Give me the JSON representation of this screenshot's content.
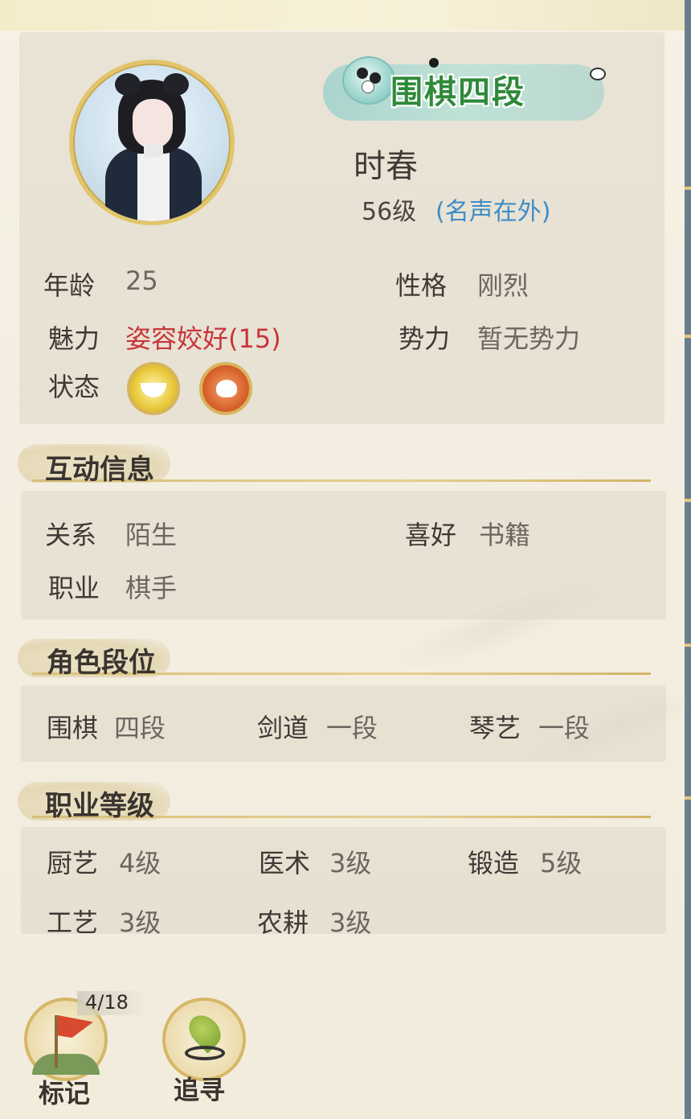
{
  "header": {
    "rank_badge": "围棋四段",
    "name": "时春",
    "level": "56级",
    "fame": "(名声在外)"
  },
  "attributes": {
    "age_label": "年龄",
    "age_value": "25",
    "personality_label": "性格",
    "personality_value": "刚烈",
    "charm_label": "魅力",
    "charm_value": "姿容姣好(15)",
    "faction_label": "势力",
    "faction_value": "暂无势力",
    "status_label": "状态",
    "status_icons": [
      "bowl-icon",
      "chained-heart-icon"
    ]
  },
  "interaction": {
    "title": "互动信息",
    "relation_label": "关系",
    "relation_value": "陌生",
    "hobby_label": "喜好",
    "hobby_value": "书籍",
    "job_label": "职业",
    "job_value": "棋手"
  },
  "rank": {
    "title": "角色段位",
    "items": [
      {
        "label": "围棋",
        "value": "四段"
      },
      {
        "label": "剑道",
        "value": "一段"
      },
      {
        "label": "琴艺",
        "value": "一段"
      }
    ]
  },
  "profession": {
    "title": "职业等级",
    "items": [
      {
        "label": "厨艺",
        "value": "4级"
      },
      {
        "label": "医术",
        "value": "3级"
      },
      {
        "label": "锻造",
        "value": "5级"
      },
      {
        "label": "工艺",
        "value": "3级"
      },
      {
        "label": "农耕",
        "value": "3级"
      }
    ]
  },
  "footer": {
    "mark_label": "标记",
    "mark_count": "4/18",
    "track_label": "追寻"
  },
  "colors": {
    "charm_red": "#c8353a",
    "fame_blue": "#3f8cc6",
    "rank_green": "#2f8a3a",
    "gold_border": "#e2c56a"
  }
}
